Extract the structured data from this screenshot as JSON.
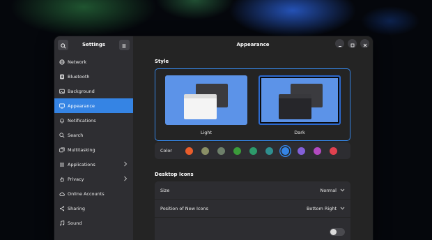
{
  "window": {
    "sidebar_title": "Settings",
    "main_title": "Appearance"
  },
  "sidebar": {
    "items": [
      {
        "label": "Network",
        "icon": "network-icon",
        "active": false,
        "chevron": false
      },
      {
        "label": "Bluetooth",
        "icon": "bluetooth-icon",
        "active": false,
        "chevron": false
      },
      {
        "label": "Background",
        "icon": "background-icon",
        "active": false,
        "chevron": false
      },
      {
        "label": "Appearance",
        "icon": "appearance-icon",
        "active": true,
        "chevron": false
      },
      {
        "label": "Notifications",
        "icon": "bell-icon",
        "active": false,
        "chevron": false
      },
      {
        "label": "Search",
        "icon": "search-icon",
        "active": false,
        "chevron": false
      },
      {
        "label": "Multitasking",
        "icon": "multitasking-icon",
        "active": false,
        "chevron": false
      },
      {
        "label": "Applications",
        "icon": "applications-icon",
        "active": false,
        "chevron": true
      },
      {
        "label": "Privacy",
        "icon": "hand-icon",
        "active": false,
        "chevron": true
      },
      {
        "label": "Online Accounts",
        "icon": "cloud-icon",
        "active": false,
        "chevron": false
      },
      {
        "label": "Sharing",
        "icon": "share-icon",
        "active": false,
        "chevron": false
      },
      {
        "label": "Sound",
        "icon": "music-note-icon",
        "active": false,
        "chevron": false
      }
    ]
  },
  "style": {
    "section_title": "Style",
    "light_label": "Light",
    "dark_label": "Dark",
    "selected": "Dark"
  },
  "color": {
    "label": "Color",
    "swatches": [
      "#e95d2b",
      "#8a8f66",
      "#6d7f6a",
      "#3b9b3a",
      "#2d9a6a",
      "#2f8f8f",
      "#3584e4",
      "#8360d8",
      "#b24ac0",
      "#e0414f"
    ],
    "selected_index": 6
  },
  "desktop_icons": {
    "section_title": "Desktop Icons",
    "size_label": "Size",
    "size_value": "Normal",
    "position_label": "Position of New Icons",
    "position_value": "Bottom Right"
  },
  "colors": {
    "accent": "#3584e4",
    "window_bg": "#242424",
    "sidebar_bg": "#2e2e32"
  }
}
